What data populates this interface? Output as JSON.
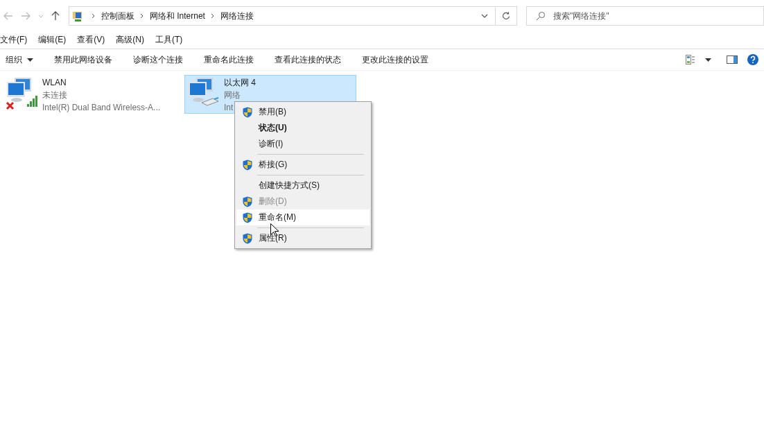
{
  "address_bar": {
    "breadcrumbs": [
      "控制面板",
      "网络和 Internet",
      "网络连接"
    ]
  },
  "search": {
    "placeholder": "搜索\"网络连接\""
  },
  "menu_bar": [
    "文件(F)",
    "编辑(E)",
    "查看(V)",
    "高级(N)",
    "工具(T)"
  ],
  "toolbar": {
    "organize": "组织",
    "actions": [
      "禁用此网络设备",
      "诊断这个连接",
      "重命名此连接",
      "查看此连接的状态",
      "更改此连接的设置"
    ]
  },
  "connections": [
    {
      "name": "WLAN",
      "status": "未连接",
      "device": "Intel(R) Dual Band Wireless-A...",
      "kind": "wireless",
      "disconnected": true,
      "selected": false
    },
    {
      "name": "以太网 4",
      "status": "网络",
      "device": "Int",
      "kind": "ethernet",
      "disconnected": false,
      "selected": true
    }
  ],
  "context_menu": [
    {
      "kind": "item",
      "label": "禁用(B)",
      "shield": true,
      "bold": false,
      "disabled": false,
      "selected": false
    },
    {
      "kind": "item",
      "label": "状态(U)",
      "shield": false,
      "bold": true,
      "disabled": false,
      "selected": false
    },
    {
      "kind": "item",
      "label": "诊断(I)",
      "shield": false,
      "bold": false,
      "disabled": false,
      "selected": false
    },
    {
      "kind": "separator"
    },
    {
      "kind": "item",
      "label": "桥接(G)",
      "shield": true,
      "bold": false,
      "disabled": false,
      "selected": false
    },
    {
      "kind": "separator"
    },
    {
      "kind": "item",
      "label": "创建快捷方式(S)",
      "shield": false,
      "bold": false,
      "disabled": false,
      "selected": false
    },
    {
      "kind": "item",
      "label": "删除(D)",
      "shield": true,
      "bold": false,
      "disabled": true,
      "selected": false
    },
    {
      "kind": "item",
      "label": "重命名(M)",
      "shield": true,
      "bold": false,
      "disabled": false,
      "selected": true
    },
    {
      "kind": "separator"
    },
    {
      "kind": "item",
      "label": "属性(R)",
      "shield": true,
      "bold": false,
      "disabled": false,
      "selected": false
    }
  ]
}
